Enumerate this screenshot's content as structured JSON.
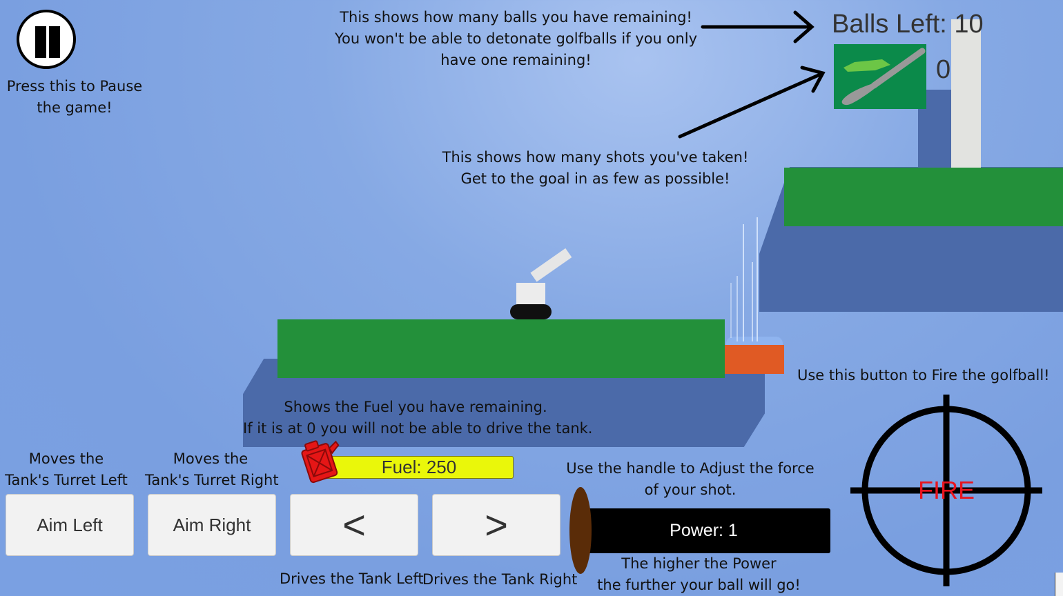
{
  "hud": {
    "balls_left": "Balls Left: 10",
    "shot_count": "0",
    "pause_icon": "pause-icon",
    "shots_icon": "golf-club-icon"
  },
  "tips": {
    "pause": [
      "Press this to Pause",
      "the game!"
    ],
    "balls": [
      "This shows how many balls you have remaining!",
      "You won't be able to detonate golfballs if you only",
      "have one remaining!"
    ],
    "shots": [
      "This shows how many shots you've taken!",
      "Get to the goal in as few as possible!"
    ],
    "fuel": [
      "Shows the Fuel you have remaining.",
      "If it is at 0 you will not be able to drive the tank."
    ],
    "aim_left": [
      "Moves the",
      "Tank's Turret Left"
    ],
    "aim_right": [
      "Moves the",
      "Tank's Turret Right"
    ],
    "power_top": [
      "Use the handle to Adjust the force",
      "of your shot."
    ],
    "power_bottom": [
      "The higher the Power",
      "the further your ball will go!"
    ],
    "fire": "Use this button to Fire the golfball!",
    "drive_left": "Drives the Tank Left",
    "drive_right": "Drives the Tank Right"
  },
  "controls": {
    "aim_left": "Aim Left",
    "aim_right": "Aim Right",
    "drive_left": "<",
    "drive_right": ">",
    "fuel": "Fuel: 250",
    "fuel_icon": "fuel-can-icon",
    "power": "Power: 1",
    "fire": "FIRE",
    "fire_icon": "crosshair-icon"
  },
  "colors": {
    "sky": "#7ea3e2",
    "platform": "#23903a",
    "lava": "#e05a24",
    "fuel_bar": "#eaf70a",
    "fire_text": "#e8141e"
  }
}
